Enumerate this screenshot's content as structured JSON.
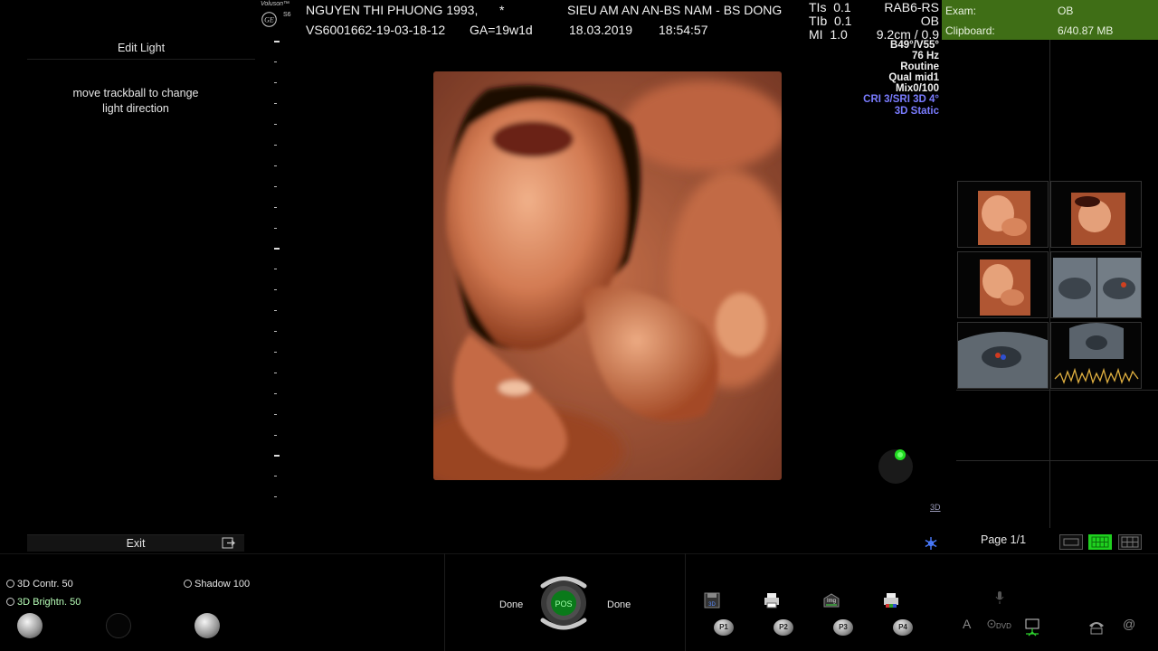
{
  "logo": {
    "brand": "Voluson™",
    "model": "S6"
  },
  "header": {
    "patient_name": "NGUYEN THI PHUONG 1993,",
    "patient_marker": "*",
    "exam_id": "VS6001662-19-03-18-12",
    "ga": "GA=19w1d",
    "institution": "SIEU AM AN AN-BS NAM - BS DONG",
    "date": "18.03.2019",
    "time": "18:54:57",
    "tis": "TIs  0.1",
    "tib": "TIb  0.1",
    "mi": "MI  1.0",
    "probe": "RAB6-RS",
    "app": "OB",
    "depth": "9.2cm / 0.9"
  },
  "params": [
    "B49°/V55°",
    "76 Hz",
    "Routine",
    "Qual mid1",
    "Mix0/100"
  ],
  "params_accent": [
    "CRI 3/SRI 3D 4°",
    "3D Static"
  ],
  "exam_info": {
    "exam_label": "Exam:",
    "exam_value": "OB",
    "clipboard_label": "Clipboard:",
    "clipboard_value": "6/40.87 MB"
  },
  "left_panel": {
    "title": "Edit Light",
    "help_line1": "move trackball to change",
    "help_line2": "light direction",
    "exit_label": "Exit"
  },
  "view_label_3d": "3D",
  "clipboard": {
    "page_label": "Page 1/1"
  },
  "controls": {
    "contrast": "3D Contr. 50",
    "brightness": "3D Brightn. 50",
    "shadow": "Shadow 100",
    "pos_label": "POS",
    "done_left": "Done",
    "done_right": "Done",
    "p1": "P1",
    "p2": "P2",
    "p3": "P3",
    "p4": "P4",
    "icon_3d": "3D",
    "icon_img": "Img",
    "letter_a": "A",
    "dvd": "DVD",
    "at": "@"
  },
  "colors": {
    "accent_green": "#1fcf1f",
    "exam_bar": "#3f6e16",
    "param_accent": "#7a7cff",
    "tissue": "#c8643f"
  }
}
